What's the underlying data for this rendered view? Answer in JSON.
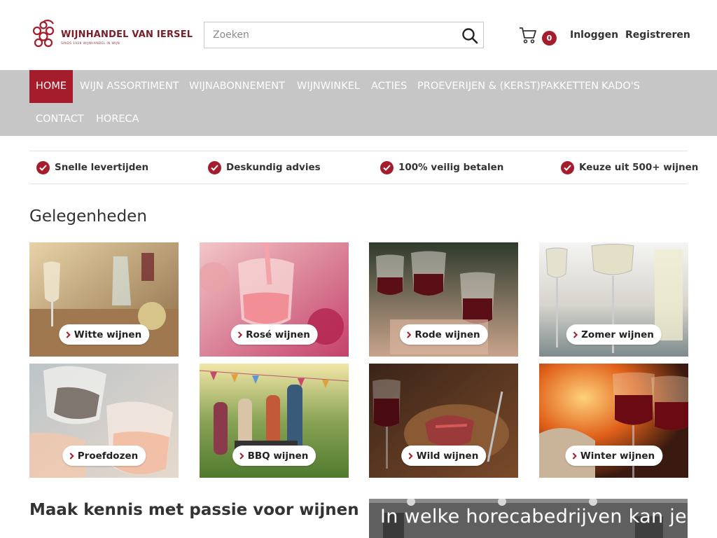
{
  "brand": {
    "name": "WIJNHANDEL VAN IERSEL",
    "tagline": "SINDS 1928 WIJNHANDEL IN WIJN",
    "accent_color": "#a51d2d",
    "nav_bg_color": "#c6c6c6"
  },
  "search": {
    "placeholder": "Zoeken",
    "icon": "search-icon"
  },
  "cart": {
    "count": "0",
    "icon": "shopping-cart-icon"
  },
  "account": {
    "login_label": "Inloggen",
    "register_label": "Registreren"
  },
  "nav": {
    "items": [
      {
        "label": "HOME",
        "active": true
      },
      {
        "label": "WIJN ASSORTIMENT"
      },
      {
        "label": "WIJNABONNEMENT"
      },
      {
        "label": "WIJNWINKEL"
      },
      {
        "label": "ACTIES"
      },
      {
        "label": "PROEVERIJEN & (KERST)PAKKETTEN"
      },
      {
        "label": "KADO'S"
      },
      {
        "label": "CONTACT"
      },
      {
        "label": "HORECA"
      }
    ]
  },
  "usps": [
    {
      "label": "Snelle levertijden",
      "icon": "check-circle-icon"
    },
    {
      "label": "Deskundig advies",
      "icon": "check-circle-icon"
    },
    {
      "label": "100% veilig betalen",
      "icon": "check-circle-icon"
    },
    {
      "label": "Keuze uit 500+ wijnen",
      "icon": "check-circle-icon"
    }
  ],
  "occasions": {
    "title": "Gelegenheden",
    "tiles": [
      {
        "label": "Witte wijnen"
      },
      {
        "label": "Rosé wijnen"
      },
      {
        "label": "Rode wijnen"
      },
      {
        "label": "Zomer wijnen"
      },
      {
        "label": "Proefdozen"
      },
      {
        "label": "BBQ wijnen"
      },
      {
        "label": "Wild wijnen"
      },
      {
        "label": "Winter wijnen"
      }
    ]
  },
  "passion": {
    "title": "Maak kennis met passie voor wijnen"
  },
  "horeca_banner": {
    "text": "In welke horecabedrijven kan je"
  }
}
